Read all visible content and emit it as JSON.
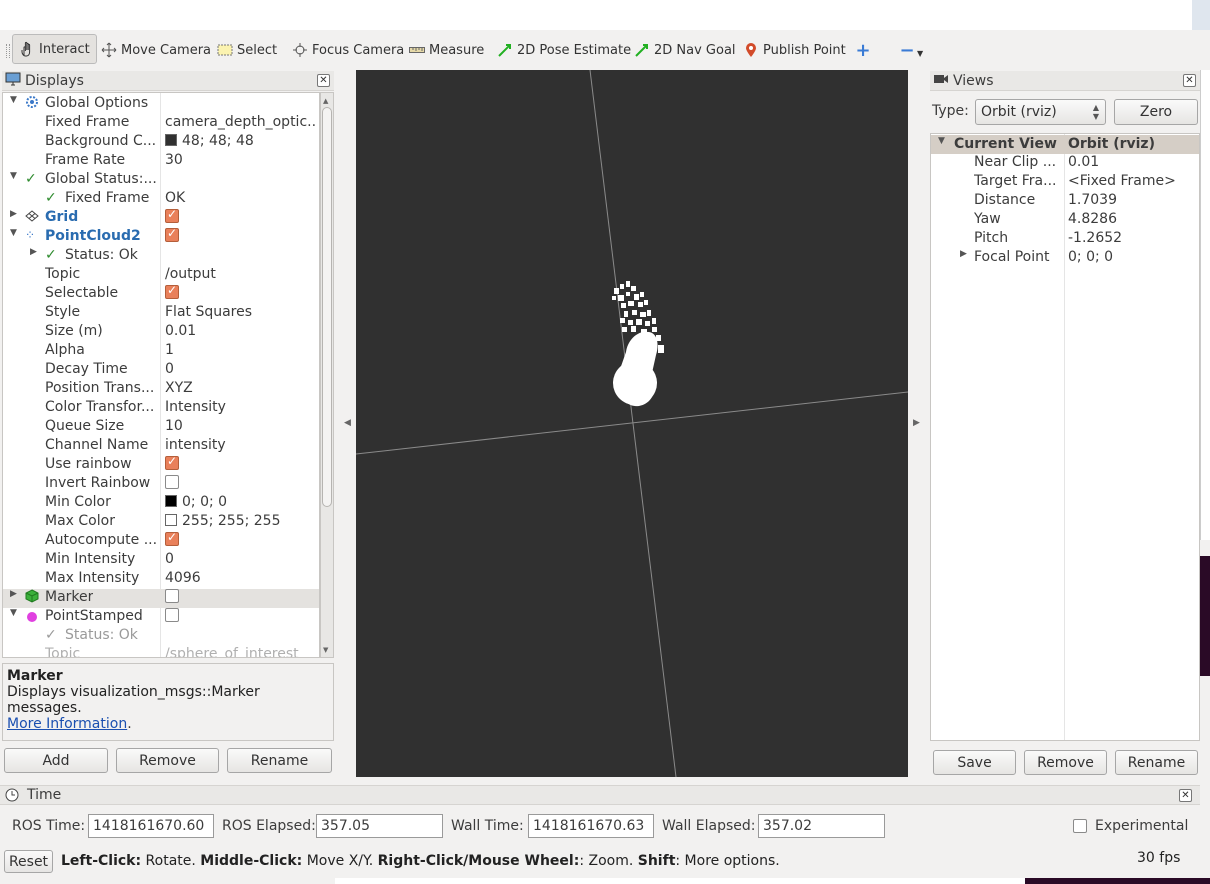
{
  "toolbar": {
    "tools": [
      {
        "label": "Interact",
        "icon": "hand-icon"
      },
      {
        "label": "Move Camera",
        "icon": "move-camera-icon"
      },
      {
        "label": "Select",
        "icon": "select-icon"
      },
      {
        "label": "Focus Camera",
        "icon": "focus-camera-icon"
      },
      {
        "label": "Measure",
        "icon": "ruler-icon"
      },
      {
        "label": "2D Pose Estimate",
        "icon": "arrow-green-icon"
      },
      {
        "label": "2D Nav Goal",
        "icon": "arrow-green-icon"
      },
      {
        "label": "Publish Point",
        "icon": "map-pin-icon"
      }
    ]
  },
  "displays": {
    "title": "Displays",
    "rows": [
      {
        "name": "Global Options",
        "value": ""
      },
      {
        "name": "Fixed Frame",
        "value": "camera_depth_optic..."
      },
      {
        "name": "Background C...",
        "value": "48; 48; 48"
      },
      {
        "name": "Frame Rate",
        "value": "30"
      },
      {
        "name": "Global Status:...",
        "value": ""
      },
      {
        "name": "Fixed Frame",
        "value": "OK"
      },
      {
        "name": "Grid",
        "value": ""
      },
      {
        "name": "PointCloud2",
        "value": ""
      },
      {
        "name": "Status: Ok",
        "value": ""
      },
      {
        "name": "Topic",
        "value": "/output"
      },
      {
        "name": "Selectable",
        "value": ""
      },
      {
        "name": "Style",
        "value": "Flat Squares"
      },
      {
        "name": "Size (m)",
        "value": "0.01"
      },
      {
        "name": "Alpha",
        "value": "1"
      },
      {
        "name": "Decay Time",
        "value": "0"
      },
      {
        "name": "Position Trans...",
        "value": "XYZ"
      },
      {
        "name": "Color Transfor...",
        "value": "Intensity"
      },
      {
        "name": "Queue Size",
        "value": "10"
      },
      {
        "name": "Channel Name",
        "value": "intensity"
      },
      {
        "name": "Use rainbow",
        "value": ""
      },
      {
        "name": "Invert Rainbow",
        "value": ""
      },
      {
        "name": "Min Color",
        "value": "0; 0; 0"
      },
      {
        "name": "Max Color",
        "value": "255; 255; 255"
      },
      {
        "name": "Autocompute ...",
        "value": ""
      },
      {
        "name": "Min Intensity",
        "value": "0"
      },
      {
        "name": "Max Intensity",
        "value": "4096"
      },
      {
        "name": "Marker",
        "value": ""
      },
      {
        "name": "PointStamped",
        "value": ""
      },
      {
        "name": "Status: Ok",
        "value": ""
      },
      {
        "name": "Topic",
        "value": "/sphere_of_interest"
      }
    ],
    "desc_title": "Marker",
    "desc_text": "Displays visualization_msgs::Marker messages.",
    "desc_link": "More Information",
    "desc_period": ".",
    "add": "Add",
    "remove": "Remove",
    "rename": "Rename"
  },
  "views": {
    "title": "Views",
    "type_label": "Type:",
    "type_value": "Orbit (rviz)",
    "zero": "Zero",
    "header_name": "Current View",
    "header_value": "Orbit (rviz)",
    "rows": [
      {
        "name": "Near Clip ...",
        "value": "0.01"
      },
      {
        "name": "Target Fra...",
        "value": "<Fixed Frame>"
      },
      {
        "name": "Distance",
        "value": "1.7039"
      },
      {
        "name": "Yaw",
        "value": "4.8286"
      },
      {
        "name": "Pitch",
        "value": "-1.2652"
      },
      {
        "name": "Focal Point",
        "value": "0; 0; 0"
      }
    ],
    "save": "Save",
    "remove": "Remove",
    "rename": "Rename"
  },
  "time": {
    "title": "Time",
    "ros_time_label": "ROS Time:",
    "ros_time": "1418161670.60",
    "ros_elapsed_label": "ROS Elapsed:",
    "ros_elapsed": "357.05",
    "wall_time_label": "Wall Time:",
    "wall_time": "1418161670.63",
    "wall_elapsed_label": "Wall Elapsed:",
    "wall_elapsed": "357.02",
    "experimental": "Experimental"
  },
  "status": {
    "reset": "Reset",
    "left_click": "Left-Click:",
    "left_text": " Rotate. ",
    "middle_click": "Middle-Click:",
    "middle_text": " Move X/Y. ",
    "right_click": "Right-Click/Mouse Wheel:",
    "right_text": ": Zoom. ",
    "shift": "Shift",
    "shift_text": ": More options.",
    "fps": "30 fps"
  },
  "colors": {
    "viewport_bg": "#303030",
    "accent_check": "#e9805a",
    "link": "#1a4fb0"
  }
}
